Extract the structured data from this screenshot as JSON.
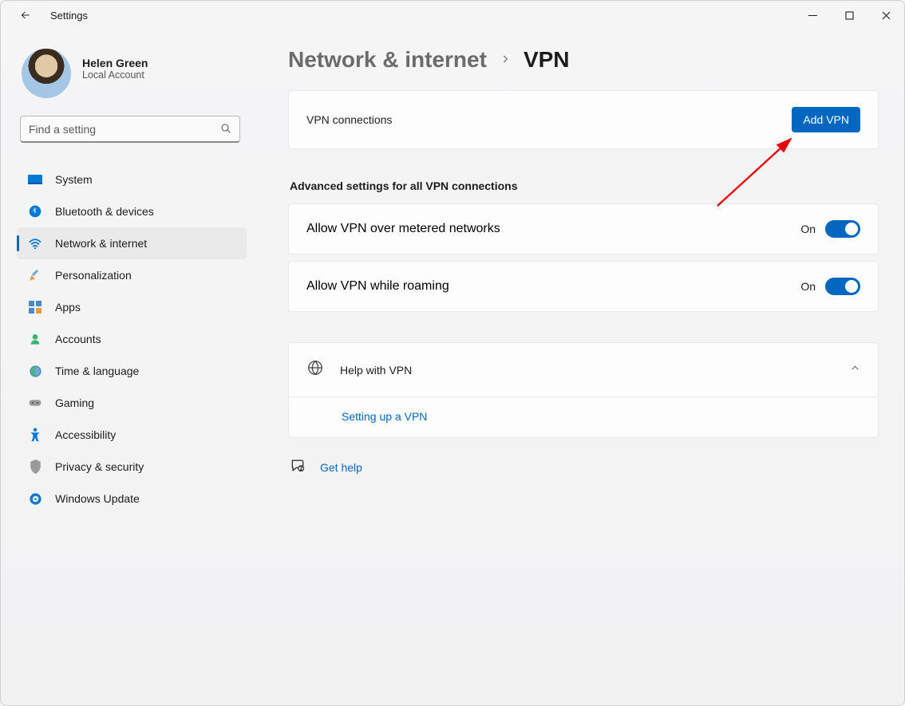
{
  "window": {
    "app_title": "Settings"
  },
  "profile": {
    "name": "Helen Green",
    "subtitle": "Local Account"
  },
  "search": {
    "placeholder": "Find a setting"
  },
  "nav": {
    "items": [
      {
        "key": "system",
        "label": "System"
      },
      {
        "key": "bluetooth",
        "label": "Bluetooth & devices"
      },
      {
        "key": "network",
        "label": "Network & internet"
      },
      {
        "key": "personalization",
        "label": "Personalization"
      },
      {
        "key": "apps",
        "label": "Apps"
      },
      {
        "key": "accounts",
        "label": "Accounts"
      },
      {
        "key": "time",
        "label": "Time & language"
      },
      {
        "key": "gaming",
        "label": "Gaming"
      },
      {
        "key": "accessibility",
        "label": "Accessibility"
      },
      {
        "key": "privacy",
        "label": "Privacy & security"
      },
      {
        "key": "update",
        "label": "Windows Update"
      }
    ]
  },
  "breadcrumb": {
    "parent": "Network & internet",
    "current": "VPN"
  },
  "vpn_card": {
    "label": "VPN connections",
    "button": "Add VPN"
  },
  "advanced": {
    "heading": "Advanced settings for all VPN connections",
    "metered": {
      "label": "Allow VPN over metered networks",
      "state": "On"
    },
    "roaming": {
      "label": "Allow VPN while roaming",
      "state": "On"
    }
  },
  "help": {
    "header": "Help with VPN",
    "link": "Setting up a VPN"
  },
  "gethelp": {
    "label": "Get help"
  }
}
